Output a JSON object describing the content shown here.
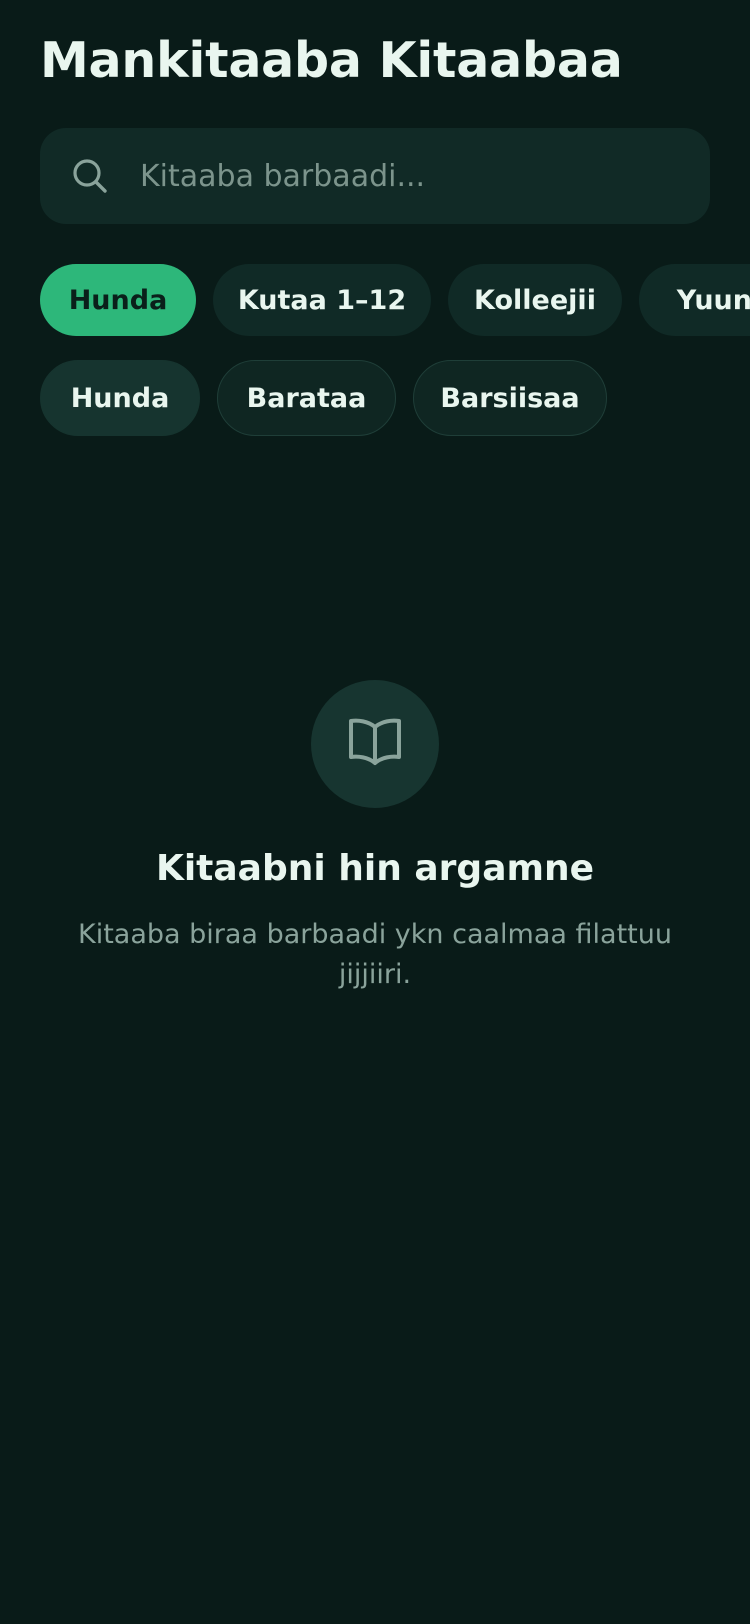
{
  "header": {
    "title": "Mankitaaba Kitaabaa"
  },
  "search": {
    "placeholder": "Kitaaba barbaadi...",
    "value": "",
    "icon": "search-icon"
  },
  "level_filters": {
    "selected": "Hunda",
    "items": [
      {
        "label": "Hunda",
        "active": true
      },
      {
        "label": "Kutaa 1–12",
        "active": false
      },
      {
        "label": "Kolleejii",
        "active": false
      },
      {
        "label": "Yuuni",
        "active": false
      }
    ]
  },
  "type_filters": {
    "selected": "Hunda",
    "items": [
      {
        "label": "Hunda",
        "active": true
      },
      {
        "label": "Baratаa",
        "active": false
      },
      {
        "label": "Barsiisaa",
        "active": false
      }
    ]
  },
  "empty_state": {
    "icon": "open-book-icon",
    "title": "Kitaabni hin argamne",
    "description": "Kitaaba biraa barbaadi ykn caalmaa filattuu jijjiiri."
  },
  "colors": {
    "background": "#091b18",
    "accent": "#2db77a",
    "surface": "#112a26",
    "muted_text": "#8aa39b"
  }
}
